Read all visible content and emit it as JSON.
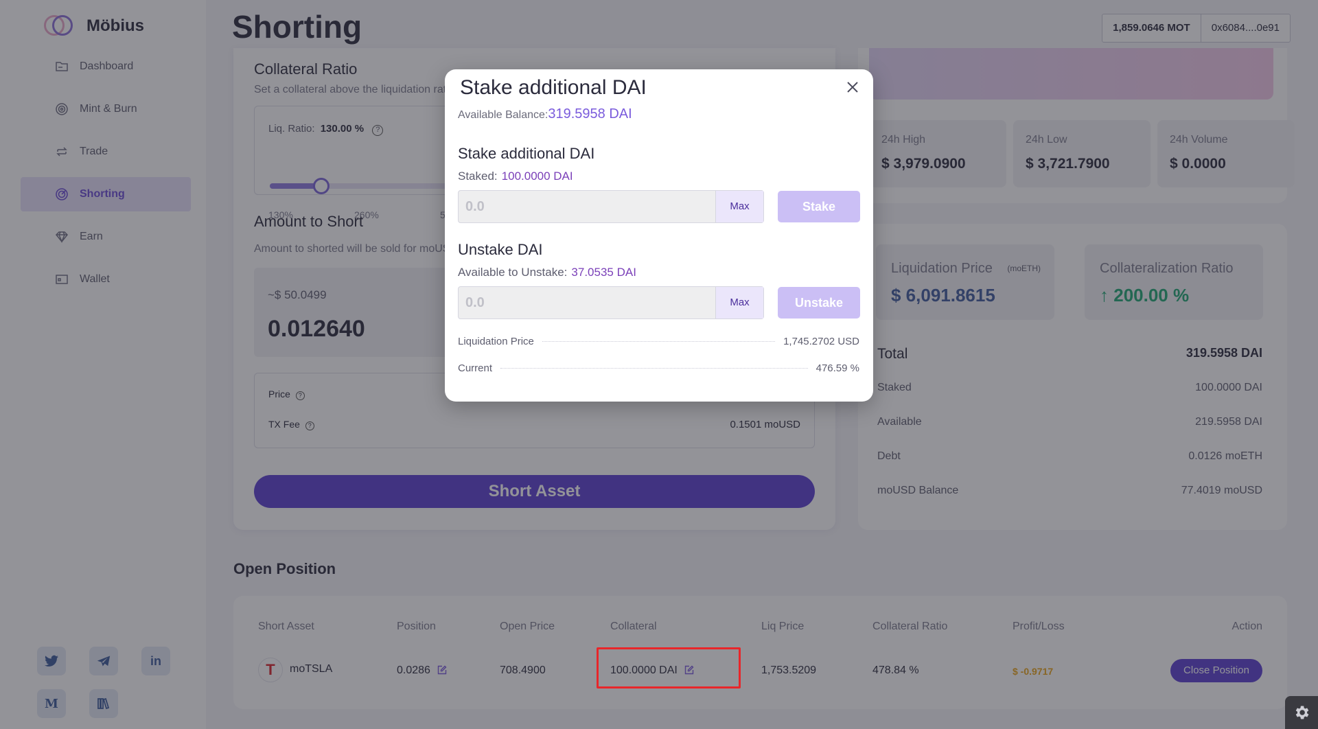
{
  "app": {
    "name": "Möbius"
  },
  "sidebar": {
    "items": [
      {
        "label": "Dashboard",
        "icon": "folder-icon"
      },
      {
        "label": "Mint & Burn",
        "icon": "target-icon"
      },
      {
        "label": "Trade",
        "icon": "swap-icon"
      },
      {
        "label": "Shorting",
        "icon": "target-icon",
        "active": true
      },
      {
        "label": "Earn",
        "icon": "diamond-icon"
      },
      {
        "label": "Wallet",
        "icon": "wallet-icon"
      }
    ],
    "socials": [
      {
        "name": "twitter-icon",
        "glyph": "🐦"
      },
      {
        "name": "telegram-icon",
        "glyph": "➤"
      },
      {
        "name": "linkedin-icon",
        "glyph": "in"
      },
      {
        "name": "medium-icon",
        "glyph": "M"
      },
      {
        "name": "gitbook-icon",
        "glyph": "📚"
      }
    ]
  },
  "header": {
    "title": "Shorting",
    "balance": "1,859.0646 MOT",
    "address": "0x6084....0e91"
  },
  "form": {
    "collateral_title": "Collateral Ratio",
    "collateral_sub": "Set a collateral above the liquidation rat",
    "liq_label": "Liq. Ratio:",
    "liq_value": "130.00 %",
    "slider_ticks": [
      "130%",
      "260%",
      "5"
    ],
    "slider_value_percent": 0.25,
    "amount_title": "Amount to Short",
    "amount_sub": "Amount to shorted will be sold for moUS",
    "amount_usd": "~$ 50.0499",
    "amount_value": "0.012640",
    "price_label": "Price",
    "fee_label": "TX Fee",
    "fee_value": "0.1501 moUSD",
    "short_button": "Short Asset"
  },
  "stats": {
    "high_label": "24h High",
    "high_value": "$ 3,979.0900",
    "low_label": "24h Low",
    "low_value": "$ 3,721.7900",
    "volume_label": "24h Volume",
    "volume_value": "$ 0.0000",
    "liq_price_label": "Liquidation Price",
    "liq_price_unit": "(moETH)",
    "liq_price_value": "$ 6,091.8615",
    "coll_ratio_label": "Collateralization Ratio",
    "coll_ratio_value": "200.00 %",
    "total_label": "Total",
    "total_value": "319.5958 DAI",
    "staked_label": "Staked",
    "staked_value": "100.0000 DAI",
    "available_label": "Available",
    "available_value": "219.5958 DAI",
    "debt_label": "Debt",
    "debt_value": "0.0126 moETH",
    "moUSD_label": "moUSD Balance",
    "moUSD_value": "77.4019 moUSD"
  },
  "positions": {
    "title": "Open Position",
    "columns": [
      "Short Asset",
      "Position",
      "Open Price",
      "Collateral",
      "Liq Price",
      "Collateral Ratio",
      "Profit/Loss",
      "Action"
    ],
    "rows": [
      {
        "asset": "moTSLA",
        "position": "0.0286",
        "open_price": "708.4900",
        "collateral": "100.0000 DAI",
        "liq_price": "1,753.5209",
        "collateral_ratio": "478.84 %",
        "profit_loss": "$ -0.9717",
        "action": "Close Position"
      }
    ]
  },
  "modal": {
    "title": "Stake additional DAI",
    "available_label": "Available Balance:",
    "available_value": "319.5958 DAI",
    "stake_section": "Stake additional DAI",
    "staked_label": "Staked:",
    "staked_value": "100.0000 DAI",
    "stake_placeholder": "0.0",
    "max_label": "Max",
    "stake_button": "Stake",
    "unstake_section": "Unstake DAI",
    "unstake_avail_label": "Available to Unstake:",
    "unstake_avail_value": "37.0535 DAI",
    "unstake_placeholder": "0.0",
    "unstake_button": "Unstake",
    "liq_label": "Liquidation Price",
    "liq_value": "1,745.2702 USD",
    "current_label": "Current",
    "current_value": "476.59 %"
  },
  "colors": {
    "accent": "#5a3fd0",
    "positive": "#1fa672",
    "negative": "#e8a317",
    "highlight": "#e8262a"
  }
}
